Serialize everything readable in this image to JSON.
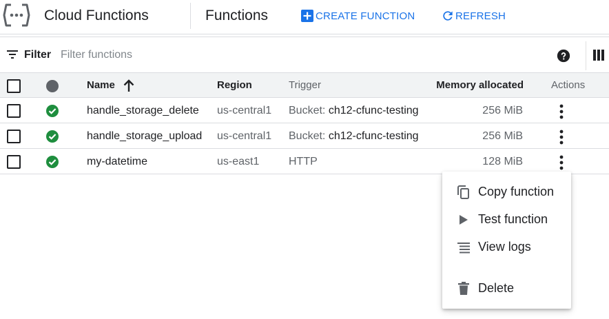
{
  "header": {
    "app_title": "Cloud Functions",
    "page_title": "Functions",
    "create_label": "CREATE FUNCTION",
    "refresh_label": "REFRESH",
    "logo_icon": "cloud-functions-logo-icon"
  },
  "filter": {
    "label": "Filter",
    "placeholder": "Filter functions",
    "value": "",
    "help_icon": "help-icon",
    "columns_icon": "column-display-icon"
  },
  "table": {
    "columns": {
      "name": "Name",
      "region": "Region",
      "trigger": "Trigger",
      "memory": "Memory allocated",
      "actions": "Actions"
    },
    "sort": {
      "column": "name",
      "direction": "ascending"
    },
    "rows": [
      {
        "name": "handle_storage_delete",
        "region": "us-central1",
        "trigger_type": "Bucket:",
        "trigger_value": "ch12-cfunc-testing",
        "memory": "256 MiB",
        "status": "ok"
      },
      {
        "name": "handle_storage_upload",
        "region": "us-central1",
        "trigger_type": "Bucket:",
        "trigger_value": "ch12-cfunc-testing",
        "memory": "256 MiB",
        "status": "ok"
      },
      {
        "name": "my-datetime",
        "region": "us-east1",
        "trigger_type": "HTTP",
        "trigger_value": "",
        "memory": "128 MiB",
        "status": "ok"
      }
    ]
  },
  "menu": {
    "items": [
      {
        "label": "Copy function",
        "icon": "copy-icon"
      },
      {
        "label": "Test function",
        "icon": "play-icon"
      },
      {
        "label": "View logs",
        "icon": "logs-icon"
      },
      {
        "label": "Delete",
        "icon": "trash-icon"
      }
    ]
  },
  "colors": {
    "accent": "#1a73e8",
    "status_ok": "#1e8e3e",
    "header_row_bg": "#f1f3f4",
    "border": "#dadce0"
  }
}
